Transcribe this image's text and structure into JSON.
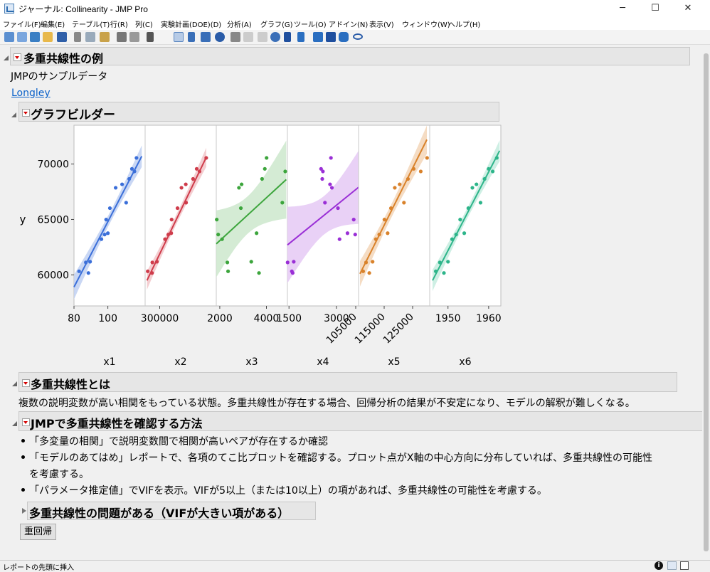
{
  "window": {
    "title": "ジャーナル: Collinearity - JMP Pro",
    "minimize_glyph": "─",
    "maximize_glyph": "☐",
    "close_glyph": "✕"
  },
  "menu": [
    "ファイル(F)",
    "編集(E)",
    "テーブル(T)",
    "行(R)",
    "列(C)",
    "実験計画(DOE)(D)",
    "分析(A)",
    "グラフ(G)",
    "ツール(O)",
    "アドイン(N)",
    "表示(V)",
    "ウィンドウ(W)",
    "ヘルプ(H)"
  ],
  "journal": {
    "section1_title": "多重共線性の例",
    "sample_label": "JMPのサンプルデータ",
    "sample_link": "Longley",
    "graph_title": "グラフビルダー",
    "section2_title": "多重共線性とは",
    "section2_text": "複数の説明変数が高い相関をもっている状態。多重共線性が存在する場合、回帰分析の結果が不安定になり、モデルの解釈が難しくなる。",
    "section3_title": "JMPで多重共線性を確認する方法",
    "bullets": [
      "「多変量の相関」で説明変数間で相関が高いペアが存在するか確認",
      "「モデルのあてはめ」レポートで、各項のてこ比プロットを確認する。プロット点がX軸の中心方向に分布していれば、多重共線性の可能性",
      "を考慮する。",
      "「パラメータ推定値」でVIFを表示。VIFが5以上（または10以上）の項があれば、多重共線性の可能性を考慮する。"
    ],
    "subsection_title": "多重共線性の問題がある（VIFが大きい項がある）",
    "button_label": "重回帰"
  },
  "status": {
    "text": "レポートの先頭に挿入",
    "info_icon": "i"
  },
  "chart_data": {
    "type": "scatter",
    "ylabel": "y",
    "ylim": [
      57200,
      73500
    ],
    "yticks": [
      60000,
      65000,
      70000
    ],
    "panels": [
      {
        "xlabel": "x1",
        "color": "#3b6fd9",
        "band": "#bfd0f2",
        "xlim": [
          80,
          122
        ],
        "xticks": [
          80,
          100
        ],
        "xtick_labels": [
          "80",
          "100"
        ],
        "rotated": false,
        "x": [
          83,
          87,
          88.5,
          89.5,
          96.2,
          98.1,
          99,
          100,
          101.2,
          104.6,
          108.4,
          110.8,
          112.6,
          114.2,
          115.7,
          116.9
        ],
        "y": [
          60323,
          61122,
          60171,
          61187,
          63221,
          63639,
          64989,
          63761,
          66019,
          67857,
          68169,
          66513,
          68655,
          69564,
          69331,
          70551
        ],
        "fit": [
          [
            80,
            58900
          ],
          [
            120,
            70700
          ]
        ]
      },
      {
        "xlabel": "x2",
        "color": "#cf3c4b",
        "band": "#f2c5c9",
        "xlim": [
          220000,
          610000
        ],
        "xticks": [
          300000
        ],
        "xtick_labels": [
          "300000"
        ],
        "rotated": false,
        "x": [
          234289,
          259426,
          258054,
          284599,
          328975,
          346999,
          365385,
          363112,
          397469,
          419180,
          442769,
          444546,
          482704,
          502601,
          518173,
          554894
        ],
        "y": [
          60323,
          61122,
          60171,
          61187,
          63221,
          63639,
          64989,
          63761,
          66019,
          67857,
          68169,
          66513,
          68655,
          69564,
          69331,
          70551
        ],
        "fit": [
          [
            230000,
            59500
          ],
          [
            555000,
            70600
          ]
        ]
      },
      {
        "xlabel": "x3",
        "color": "#3ca53c",
        "band": "#cde8cd",
        "xlim": [
          1850,
          4900
        ],
        "xticks": [
          2000,
          4000
        ],
        "xtick_labels": [
          "2000",
          "4000"
        ],
        "rotated": false,
        "x": [
          2356,
          2325,
          3682,
          3351,
          2099,
          1932,
          1870,
          3578,
          2904,
          2822,
          2936,
          4681,
          3813,
          3931,
          4806,
          4007
        ],
        "y": [
          60323,
          61122,
          60171,
          61187,
          63221,
          63639,
          64989,
          63761,
          66019,
          67857,
          68169,
          66513,
          68655,
          69564,
          69331,
          70551
        ],
        "fit": [
          [
            1850,
            62800
          ],
          [
            4850,
            68600
          ]
        ]
      },
      {
        "xlabel": "x4",
        "color": "#9a2fd6",
        "band": "#e5c9f4",
        "xlim": [
          1450,
          3700
        ],
        "xticks": [
          1500,
          3000
        ],
        "xtick_labels": [
          "1500",
          "3000"
        ],
        "rotated": false,
        "x": [
          1590,
          1456,
          1616,
          1650,
          3099,
          3594,
          3547,
          3350,
          3048,
          2857,
          2798,
          2637,
          2552,
          2514,
          2572,
          2827
        ],
        "y": [
          60323,
          61122,
          60171,
          61187,
          63221,
          63639,
          64989,
          63761,
          66019,
          67857,
          68169,
          66513,
          68655,
          69564,
          69331,
          70551
        ],
        "fit": [
          [
            1450,
            62700
          ],
          [
            3700,
            67900
          ]
        ]
      },
      {
        "xlabel": "x5",
        "color": "#d9822b",
        "band": "#f3d6b8",
        "xlim": [
          106000,
          131000
        ],
        "xticks": [
          105000,
          115000,
          125000
        ],
        "xtick_labels": [
          "105000",
          "115000",
          "125000"
        ],
        "rotated": true,
        "x": [
          107608,
          108632,
          109773,
          110929,
          112075,
          113270,
          115094,
          116219,
          117388,
          118734,
          120445,
          121950,
          123366,
          125368,
          127852,
          130081
        ],
        "y": [
          60323,
          61122,
          60171,
          61187,
          63221,
          63639,
          64989,
          63761,
          66019,
          67857,
          68169,
          66513,
          68655,
          69564,
          69331,
          70551
        ],
        "fit": [
          [
            106500,
            60100
          ],
          [
            130000,
            72200
          ]
        ]
      },
      {
        "xlabel": "x6",
        "color": "#2db58a",
        "band": "#c5ecdf",
        "xlim": [
          1945.5,
          1963
        ],
        "xticks": [
          1950,
          1960
        ],
        "xtick_labels": [
          "1950",
          "1960"
        ],
        "rotated": false,
        "x": [
          1947,
          1948,
          1949,
          1950,
          1951,
          1952,
          1953,
          1954,
          1955,
          1956,
          1957,
          1958,
          1959,
          1960,
          1961,
          1962
        ],
        "y": [
          60323,
          61122,
          60171,
          61187,
          63221,
          63639,
          64989,
          63761,
          66019,
          67857,
          68169,
          66513,
          68655,
          69564,
          69331,
          70551
        ],
        "fit": [
          [
            1946.2,
            59500
          ],
          [
            1962.7,
            71200
          ]
        ]
      }
    ]
  }
}
